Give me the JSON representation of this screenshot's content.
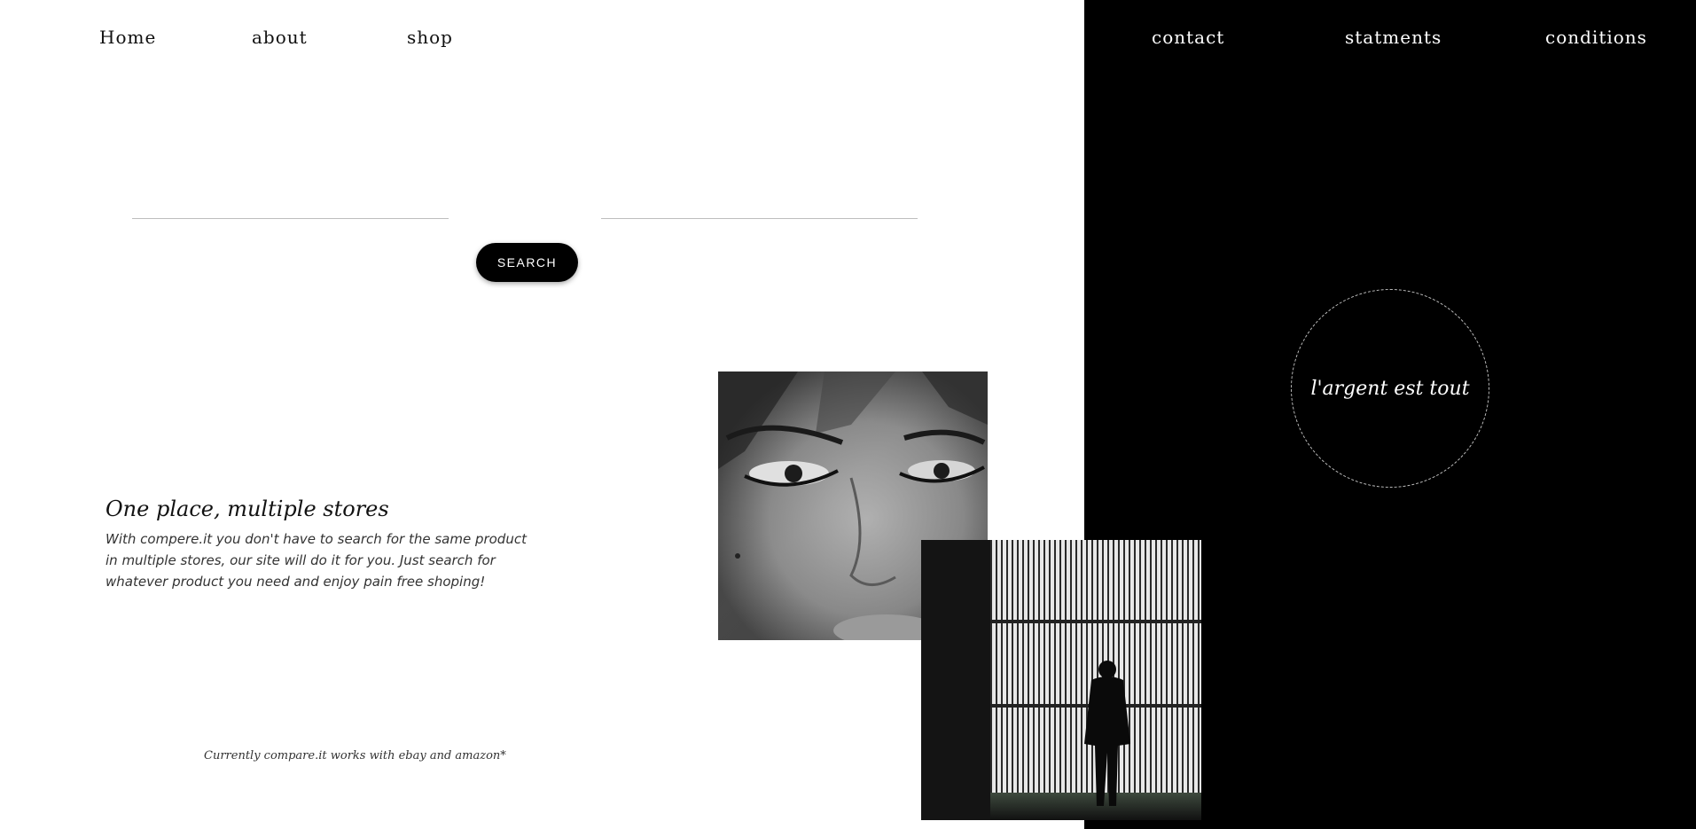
{
  "nav": {
    "left": [
      "Home",
      "about",
      "shop"
    ],
    "right": [
      "contact",
      "statments",
      "conditions"
    ]
  },
  "search": {
    "button_label": "SEARCH"
  },
  "tagline": {
    "heading": "One place, multiple stores",
    "body": "With compere.it you don't have to search for the same product in multiple stores, our site will do it for you. Just search for whatever product you need and enjoy pain free shoping!"
  },
  "footnote": "Currently compare.it works with ebay and amazon*",
  "badge": "l'argent est tout",
  "colors": {
    "panel": "#000000",
    "page": "#ffffff",
    "button": "#000000"
  }
}
